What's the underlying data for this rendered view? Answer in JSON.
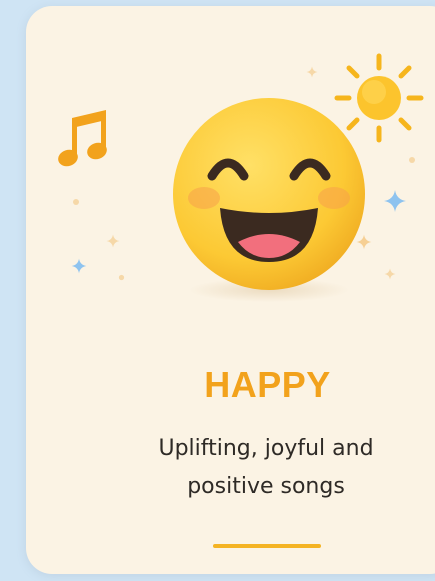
{
  "mood_card": {
    "title": "HAPPY",
    "description": "Uplifting, joyful and positive songs",
    "icons": {
      "emoji": "smiling-face-icon",
      "music": "music-note-icon",
      "sun": "sun-icon",
      "sparkles": "sparkle-icon"
    },
    "colors": {
      "background": "#cfe4f4",
      "card": "#fbf3e4",
      "accent": "#f2a21c",
      "emoji_face": "#fcc934",
      "text": "#2e2a26",
      "sparkle_blue": "#8ec3ef"
    }
  }
}
